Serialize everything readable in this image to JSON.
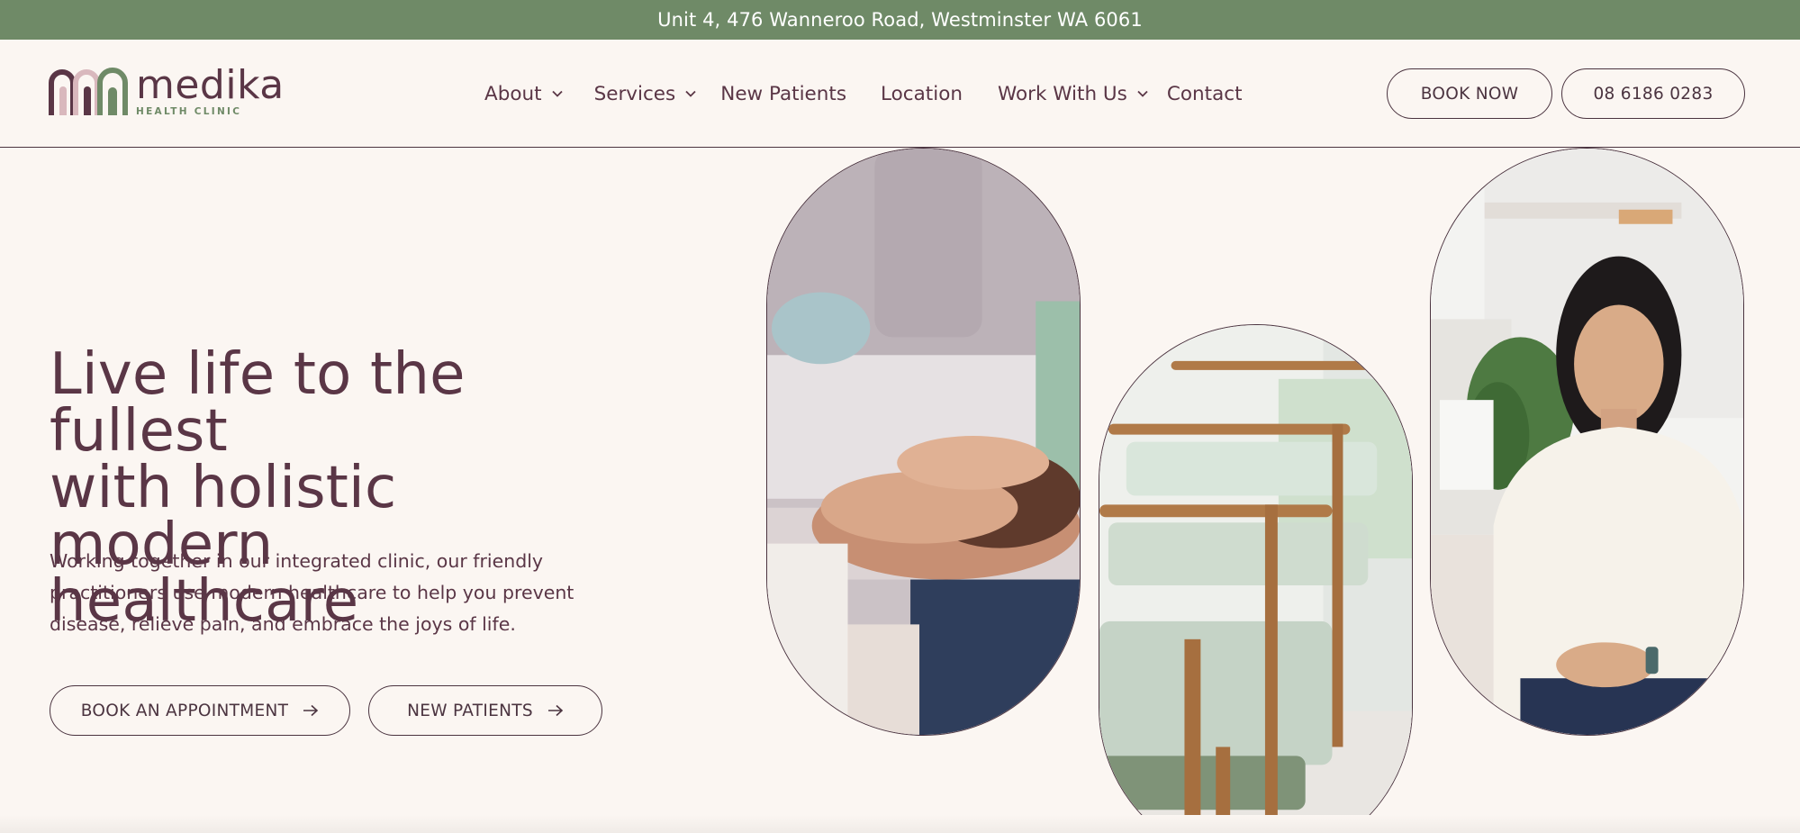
{
  "topbar": {
    "address": "Unit 4, 476 Wanneroo Road, Westminster WA 6061"
  },
  "brand": {
    "name": "medika",
    "tagline": "HEALTH CLINIC"
  },
  "nav": {
    "items": [
      {
        "label": "About",
        "has_dropdown": true
      },
      {
        "label": "Services",
        "has_dropdown": true
      },
      {
        "label": "New Patients",
        "has_dropdown": false
      },
      {
        "label": "Location",
        "has_dropdown": false
      },
      {
        "label": "Work With Us",
        "has_dropdown": true
      },
      {
        "label": "Contact",
        "has_dropdown": false
      }
    ]
  },
  "header_actions": {
    "book_label": "BOOK NOW",
    "phone_label": "08 6186 0283"
  },
  "hero": {
    "title_line1": "Live life to the fullest",
    "title_line2": "with holistic modern",
    "title_line3": "healthcare",
    "description": "Working together in our integrated clinic, our friendly practitioners use modern healthcare to help you prevent disease, relieve pain, and embrace the joys of life.",
    "cta_primary": "BOOK AN APPOINTMENT",
    "cta_secondary": "NEW PATIENTS"
  },
  "images": [
    "holding-hands-photo",
    "waiting-room-chairs-photo",
    "smiling-woman-photo"
  ],
  "colors": {
    "topbar_green": "#6f8a67",
    "text_plum": "#5a3646",
    "background_cream": "#fbf6f2",
    "logo_pink": "#d9b8bd"
  }
}
